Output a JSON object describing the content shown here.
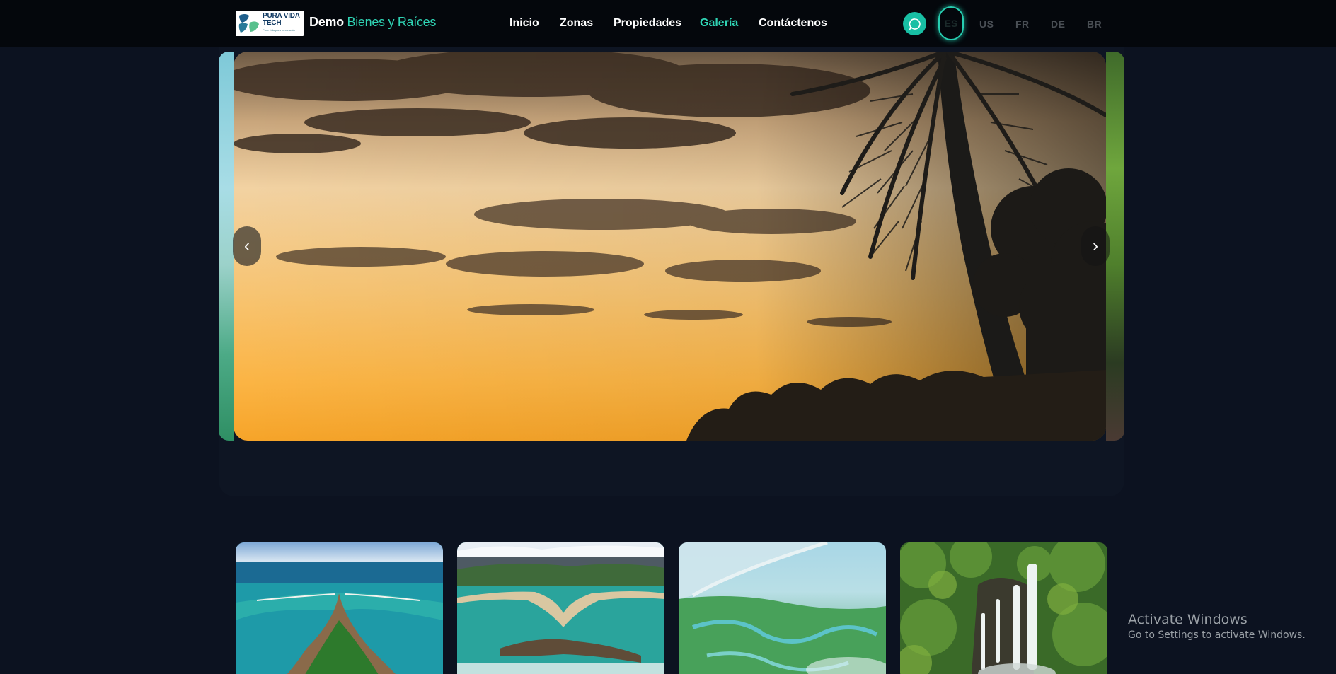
{
  "header": {
    "logo_line1": "PURA VIDA",
    "logo_line2": "TECH",
    "logo_tagline": "Pura vida para innovación",
    "brand_part1": "Demo",
    "brand_part2": "Bienes y Raíces",
    "nav": [
      {
        "label": "Inicio",
        "active": false
      },
      {
        "label": "Zonas",
        "active": false
      },
      {
        "label": "Propiedades",
        "active": false
      },
      {
        "label": "Galería",
        "active": true
      },
      {
        "label": "Contáctenos",
        "active": false
      }
    ],
    "languages": [
      "ES",
      "US",
      "FR",
      "DE",
      "BR"
    ],
    "active_language": "ES",
    "accent_color": "#2fd3b4"
  },
  "carousel": {
    "prev_label": "‹",
    "next_label": "›",
    "current_slide": "palm-sunset"
  },
  "thumbnails": [
    {
      "subject": "aerial-whale-tail-beach"
    },
    {
      "subject": "aerial-coast-mountains"
    },
    {
      "subject": "aerial-river-delta-from-plane"
    },
    {
      "subject": "waterfall-in-forest"
    }
  ],
  "watermark": {
    "title": "Activate Windows",
    "subtitle": "Go to Settings to activate Windows."
  }
}
